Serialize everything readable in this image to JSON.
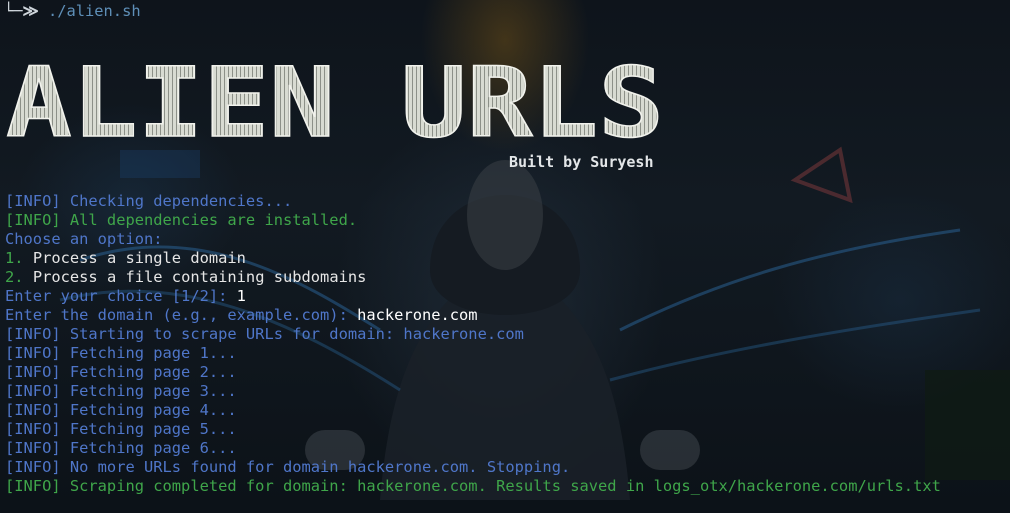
{
  "prompt": {
    "arrow": "└─≫",
    "command": "./alien.sh"
  },
  "banner": {
    "title": "ALIEN URLS",
    "credit": "Built by Suryesh"
  },
  "log": {
    "check_deps": "[INFO] Checking dependencies...",
    "deps_ok": "[INFO] All dependencies are installed.",
    "choose": "Choose an option:",
    "opt1_num": "1.",
    "opt1_text": " Process a single domain",
    "opt2_num": "2.",
    "opt2_text": " Process a file containing subdomains",
    "choice_prompt": "Enter your choice [1/2]: ",
    "choice_value": "1",
    "domain_prompt": "Enter the domain (e.g., example.com): ",
    "domain_value": "hackerone.com",
    "start": "[INFO] Starting to scrape URLs for domain: hackerone.com",
    "pages": [
      "[INFO] Fetching page 1...",
      "[INFO] Fetching page 2...",
      "[INFO] Fetching page 3...",
      "[INFO] Fetching page 4...",
      "[INFO] Fetching page 5...",
      "[INFO] Fetching page 6..."
    ],
    "stop": "[INFO] No more URLs found for domain hackerone.com. Stopping.",
    "done": "[INFO] Scraping completed for domain: hackerone.com. Results saved in logs_otx/hackerone.com/urls.txt"
  }
}
